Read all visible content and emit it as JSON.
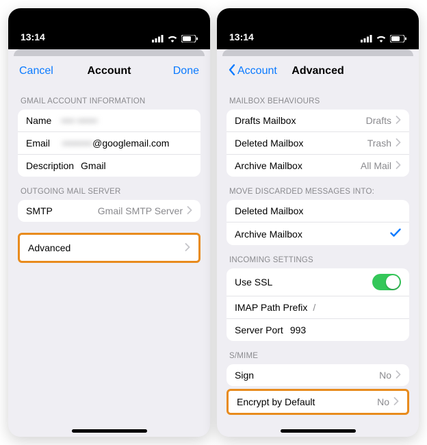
{
  "status": {
    "time": "13:14"
  },
  "left": {
    "nav": {
      "cancel": "Cancel",
      "title": "Account",
      "done": "Done"
    },
    "sectionGmail": "GMAIL ACCOUNT INFORMATION",
    "name": {
      "label": "Name",
      "value": "•••• ••••••"
    },
    "email": {
      "label": "Email",
      "prefix": "•••••••••",
      "domain": "@googlemail.com"
    },
    "description": {
      "label": "Description",
      "value": "Gmail"
    },
    "sectionOutgoing": "OUTGOING MAIL SERVER",
    "smtp": {
      "label": "SMTP",
      "value": "Gmail SMTP Server"
    },
    "advanced": {
      "label": "Advanced"
    }
  },
  "right": {
    "nav": {
      "back": "Account",
      "title": "Advanced"
    },
    "sectionBehaviours": "MAILBOX BEHAVIOURS",
    "drafts": {
      "label": "Drafts Mailbox",
      "value": "Drafts"
    },
    "deleted": {
      "label": "Deleted Mailbox",
      "value": "Trash"
    },
    "archive": {
      "label": "Archive Mailbox",
      "value": "All Mail"
    },
    "sectionDiscarded": "MOVE DISCARDED MESSAGES INTO:",
    "discardDeleted": {
      "label": "Deleted Mailbox"
    },
    "discardArchive": {
      "label": "Archive Mailbox"
    },
    "sectionIncoming": "INCOMING SETTINGS",
    "ssl": {
      "label": "Use SSL"
    },
    "imap": {
      "label": "IMAP Path Prefix",
      "value": "/"
    },
    "port": {
      "label": "Server Port",
      "value": "993"
    },
    "sectionSmime": "S/MIME",
    "sign": {
      "label": "Sign",
      "value": "No"
    },
    "encrypt": {
      "label": "Encrypt by Default",
      "value": "No"
    }
  }
}
